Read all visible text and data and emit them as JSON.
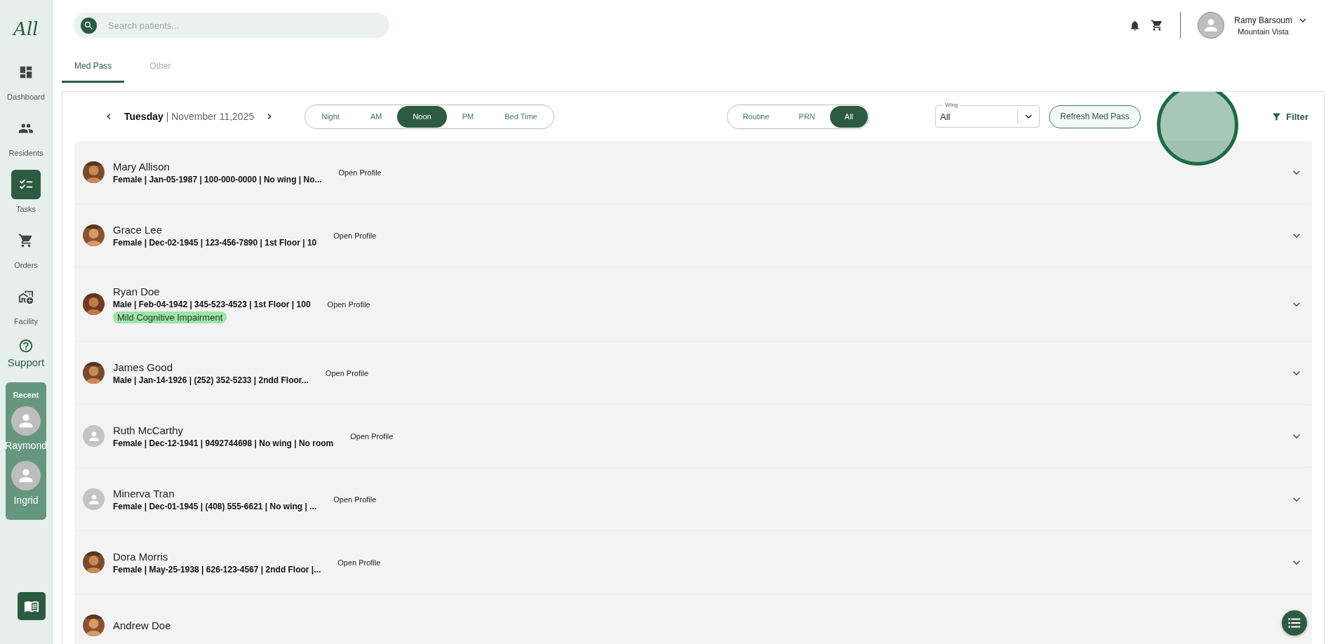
{
  "sidebar": {
    "logo": "All",
    "items": [
      {
        "label": "Dashboard",
        "selected": false
      },
      {
        "label": "Residents",
        "selected": false
      },
      {
        "label": "Tasks",
        "selected": true
      },
      {
        "label": "Orders",
        "selected": false
      },
      {
        "label": "Facility",
        "selected": false
      }
    ],
    "support": "Support",
    "recent": {
      "title": "Recent",
      "people": [
        "Raymond",
        "Ingrid"
      ]
    }
  },
  "header": {
    "search": {
      "placeholder": "Search patients..."
    },
    "user": {
      "name": "Ramy Barsoum",
      "facility": "Mountain Vista"
    }
  },
  "tabs": [
    {
      "label": "Med Pass",
      "selected": true
    },
    {
      "label": "Other",
      "selected": false
    }
  ],
  "date": "**Tuesday** | November 11,2025",
  "shifts": [
    {
      "label": "Night",
      "selected": false
    },
    {
      "label": "AM",
      "selected": false
    },
    {
      "label": "Noon",
      "selected": true
    },
    {
      "label": "PM",
      "selected": false
    },
    {
      "label": "Bed Time",
      "selected": false
    }
  ],
  "types": [
    {
      "label": "Routine",
      "selected": false
    },
    {
      "label": "PRN",
      "selected": false
    },
    {
      "label": "All",
      "selected": true
    }
  ],
  "wing": {
    "label": "Wing",
    "value": "All"
  },
  "refresh_button": "Refresh Med Pass",
  "filter": "Filter",
  "residents": [
    {
      "name": "Mary Allison",
      "details": "Female | Jan-05-1987 | 100-000-0000 | No wing | No...",
      "action": "Open Profile"
    },
    {
      "name": "Grace Lee",
      "details": "Female | Dec-02-1945 | 123-456-7890 | 1st Floor | 10",
      "action": "Open Profile"
    },
    {
      "name": "Ryan Doe",
      "details": "Male | Feb-04-1942 | 345-523-4523 | 1st Floor | 100",
      "tag": "Mild Cognitive Impairment",
      "action": "Open Profile"
    },
    {
      "name": "James Good",
      "details": "Male | Jan-14-1926 | (252) 352-5233 | 2ndd Floor...",
      "action": "Open Profile"
    },
    {
      "name": "Ruth McCarthy",
      "details": "Female | Dec-12-1941 | 9492744698 | No wing | No room",
      "action": "Open Profile",
      "kind": "placeholder"
    },
    {
      "name": "Minerva Tran",
      "details": "Female | Dec-01-1945 | (408) 555-6621 | No wing | ...",
      "action": "Open Profile",
      "kind": "placeholder"
    },
    {
      "name": "Dora Morris",
      "details": "Female | May-25-1938 | 626-123-4567 | 2ndd Floor |...",
      "action": "Open Profile"
    },
    {
      "name": "Andrew Doe"
    }
  ]
}
